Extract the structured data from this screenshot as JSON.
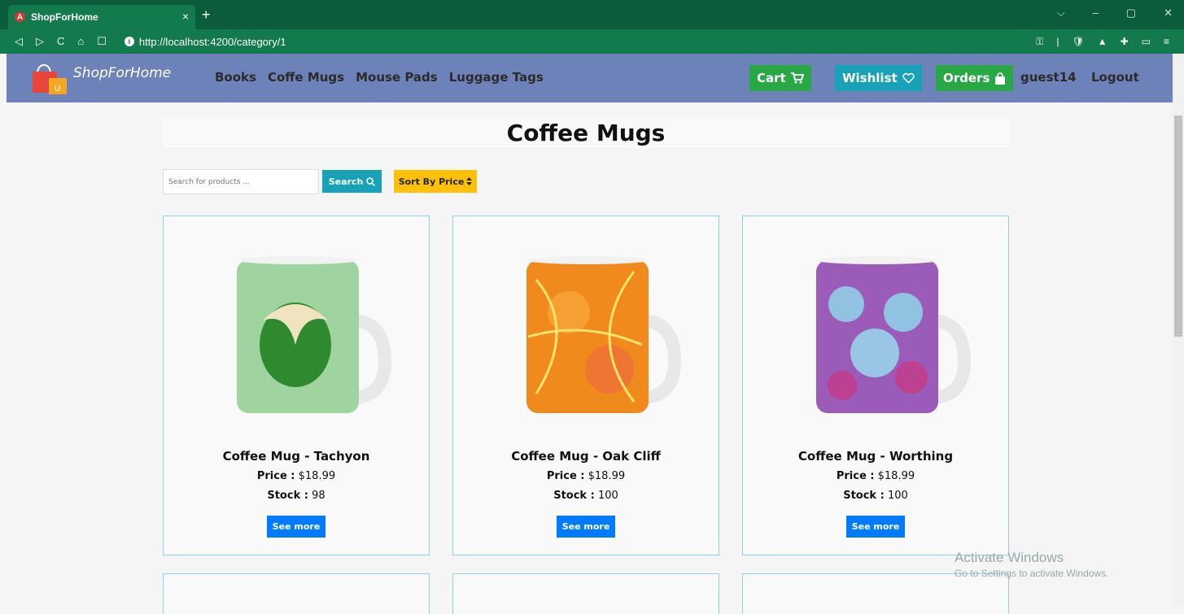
{
  "browser": {
    "tab_title": "ShopForHome",
    "favicon_letter": "A",
    "tab_close": "×",
    "new_tab": "+",
    "url": "http://localhost:4200/category/1",
    "nav_icons": [
      "◁",
      "▷",
      "C",
      "⌂",
      "☐"
    ],
    "right_icons": [
      "⚿",
      "|",
      "🛡",
      "▲",
      "✚",
      "▭",
      "≡"
    ],
    "window_controls": [
      "⌵",
      "–",
      "▢",
      "✕"
    ]
  },
  "navbar": {
    "brand": "ShopForHome",
    "menu": [
      "Books",
      "Coffe Mugs",
      "Mouse Pads",
      "Luggage Tags"
    ],
    "cart_label": "Cart",
    "wishlist_label": "Wishlist",
    "orders_label": "Orders",
    "username": "guest14",
    "logout_label": "Logout",
    "colors": {
      "navbar": "#6d82b8",
      "cart": "#28a745",
      "wishlist": "#17a2b8",
      "orders": "#28a745"
    }
  },
  "page": {
    "title": "Coffee Mugs",
    "search_placeholder": "Search for products ...",
    "search_button": "Search",
    "sort_button": "Sort By Price"
  },
  "products": [
    {
      "name": "Coffee Mug - Tachyon",
      "price_label": "Price :",
      "price": "$18.99",
      "stock_label": "Stock :",
      "stock": "98",
      "button": "See more",
      "mug_color": "#8fcf8f"
    },
    {
      "name": "Coffee Mug - Oak Cliff",
      "price_label": "Price :",
      "price": "$18.99",
      "stock_label": "Stock :",
      "stock": "100",
      "button": "See more",
      "mug_color": "#f08a1c"
    },
    {
      "name": "Coffee Mug - Worthing",
      "price_label": "Price :",
      "price": "$18.99",
      "stock_label": "Stock :",
      "stock": "100",
      "button": "See more",
      "mug_color": "#9a5cb8"
    }
  ],
  "watermark": {
    "line1": "Activate Windows",
    "line2": "Go to Settings to activate Windows."
  }
}
